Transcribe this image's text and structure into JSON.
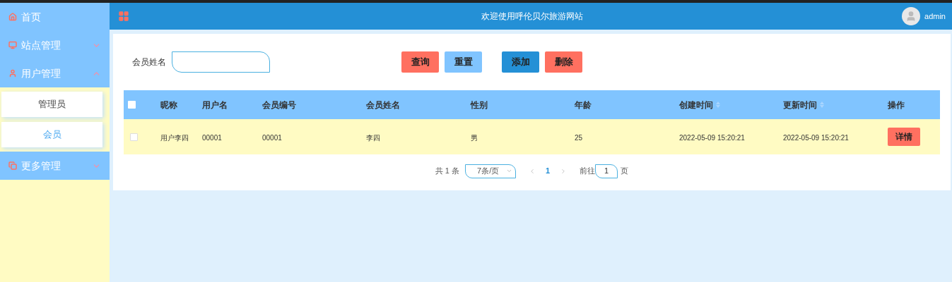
{
  "header": {
    "title": "欢迎使用呼伦贝尔旅游网站",
    "user": "admin"
  },
  "sidebar": {
    "items": [
      {
        "label": "首页"
      },
      {
        "label": "站点管理",
        "expanded": false
      },
      {
        "label": "用户管理",
        "expanded": true,
        "children": [
          {
            "label": "管理员",
            "selected": false
          },
          {
            "label": "会员",
            "selected": true
          }
        ]
      },
      {
        "label": "更多管理",
        "expanded": false
      }
    ]
  },
  "search": {
    "label": "会员姓名",
    "buttons": [
      {
        "label": "查询",
        "kind": "danger"
      },
      {
        "label": "重置",
        "kind": "light"
      },
      {
        "label": "添加",
        "kind": "primary"
      },
      {
        "label": "删除",
        "kind": "danger"
      }
    ]
  },
  "table": {
    "select_all_checked": false,
    "columns": [
      {
        "label": "昵称",
        "sortable": false
      },
      {
        "label": "用户名",
        "sortable": false
      },
      {
        "label": "会员编号",
        "sortable": false
      },
      {
        "label": "会员姓名",
        "sortable": false
      },
      {
        "label": "性别",
        "sortable": false
      },
      {
        "label": "年龄",
        "sortable": false
      },
      {
        "label": "创建时间",
        "sortable": true
      },
      {
        "label": "更新时间",
        "sortable": true
      },
      {
        "label": "操作",
        "sortable": false
      }
    ],
    "rows": [
      {
        "checked": false,
        "cells": [
          "用户李四",
          "00001",
          "00001",
          "李四",
          "男",
          "25",
          "2022-05-09 15:20:21",
          "2022-05-09 15:20:21"
        ],
        "action": "详情"
      }
    ]
  },
  "pagination": {
    "total": "共 1 条",
    "page_size": "7条/页",
    "pages": [
      {
        "label": "1",
        "selected": true
      }
    ],
    "goto_label": "前往",
    "goto_value": "1",
    "goto_suffix": "页"
  }
}
